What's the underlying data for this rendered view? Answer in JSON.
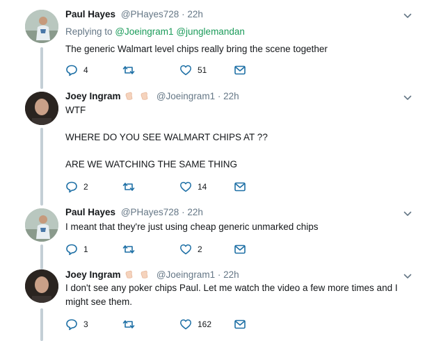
{
  "tweets": [
    {
      "name": "Paul Hayes",
      "handle": "@PHayes728",
      "sep": "·",
      "time": "22h",
      "replying_prefix": "Replying to",
      "replying_mentions": [
        "@Joeingram1",
        "@junglemandan"
      ],
      "text_lines": [
        "The generic Walmart level chips really bring the scene together"
      ],
      "reply_count": "4",
      "like_count": "51",
      "avatar": "paul-hayes-avatar"
    },
    {
      "name": "Joey Ingram",
      "handle": "@Joeingram1",
      "sep": "·",
      "time": "22h",
      "text_lines": [
        "WTF",
        "",
        "WHERE DO YOU SEE WALMART CHIPS AT ??",
        "",
        "ARE WE WATCHING THE SAME THING"
      ],
      "reply_count": "2",
      "like_count": "14",
      "avatar": "joey-ingram-avatar"
    },
    {
      "name": "Paul Hayes",
      "handle": "@PHayes728",
      "sep": "·",
      "time": "22h",
      "text_lines": [
        "I meant that they're just using cheap generic unmarked chips"
      ],
      "reply_count": "1",
      "like_count": "2",
      "avatar": "paul-hayes-avatar"
    },
    {
      "name": "Joey Ingram",
      "handle": "@Joeingram1",
      "sep": "·",
      "time": "22h",
      "text_lines": [
        "I don't see any poker chips Paul. Let me watch the video a few more times and I",
        "might see them."
      ],
      "reply_count": "3",
      "like_count": "162",
      "avatar": "joey-ingram-avatar"
    }
  ],
  "icons": {
    "reply": "reply-icon",
    "retweet": "retweet-icon",
    "like": "heart-icon",
    "message": "envelope-icon",
    "caret": "chevron-down-icon",
    "badge": "clapping-hands-emoji"
  },
  "colors": {
    "thread_line": "#c4cfd6",
    "mention": "#1b9b5a",
    "muted": "#657786",
    "text": "#14171a"
  }
}
